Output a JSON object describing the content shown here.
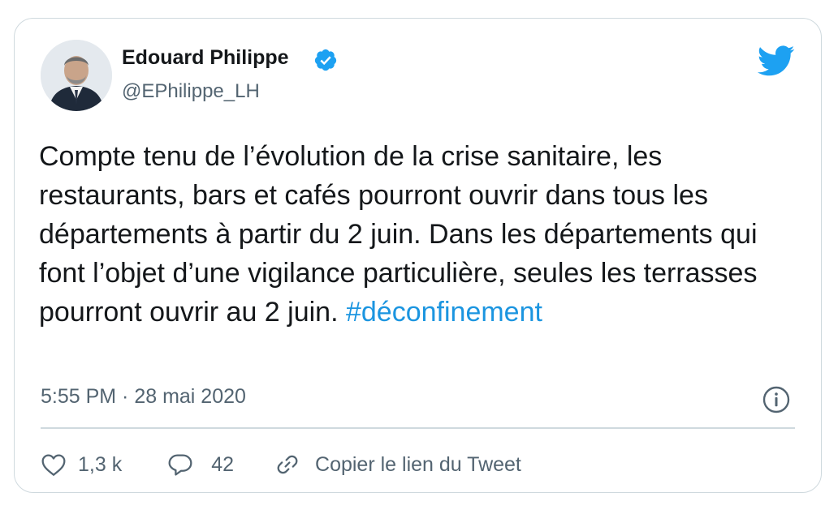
{
  "author": {
    "name": "Edouard Philippe",
    "handle": "@EPhilippe_LH"
  },
  "tweet": {
    "text": "Compte tenu de l’évolution de la crise sanitaire, les restaurants, bars et cafés pourront ouvrir dans tous les départements à partir du 2 juin. Dans les départements qui font l’objet d’une vigilance particulière, seules les terrasses pourront ouvrir au 2 juin. ",
    "hashtag": "#déconfinement",
    "timestamp": "5:55 PM · 28 mai 2020"
  },
  "actions": {
    "like_count": "1,3 k",
    "reply_count": "42",
    "copy_link_label": "Copier le lien du Tweet"
  },
  "icons": {
    "verified": "verified-badge-icon",
    "brand": "twitter-bird-icon",
    "info": "info-icon",
    "like": "heart-icon",
    "reply": "speech-bubble-icon",
    "link": "link-icon"
  },
  "colors": {
    "brand_blue": "#1da1f2",
    "hashtag": "#1b95e0",
    "secondary_text": "#536471",
    "border": "#cfd9de"
  }
}
